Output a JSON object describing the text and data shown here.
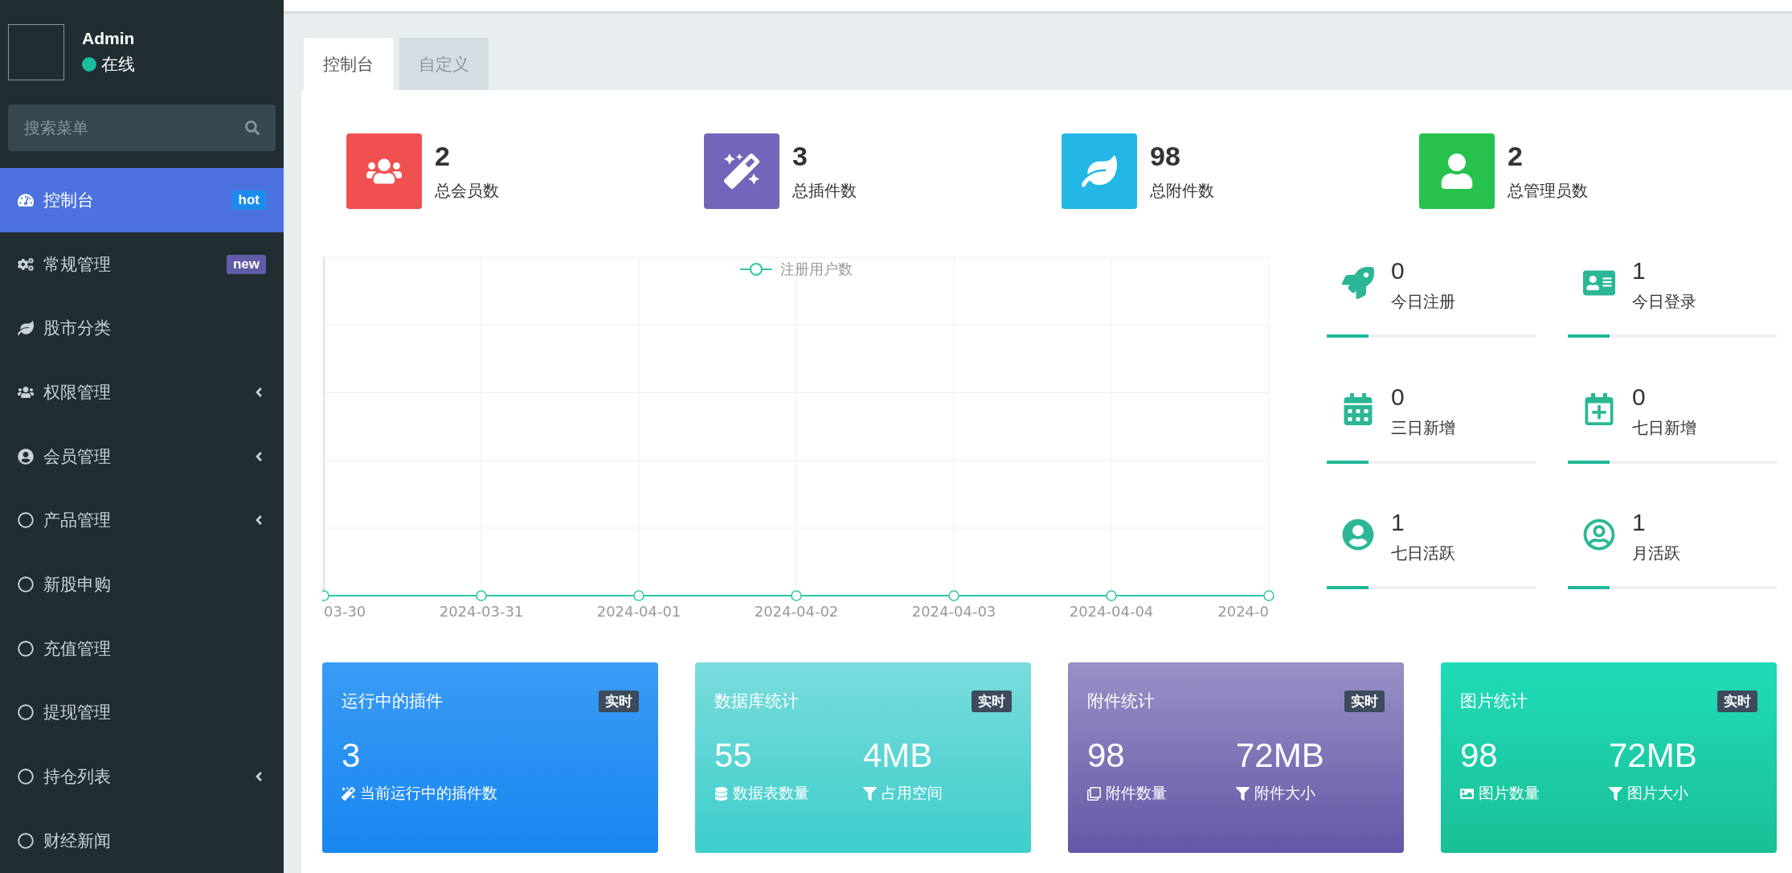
{
  "sidebar": {
    "user": {
      "name": "Admin",
      "status": "在线",
      "online": true
    },
    "search": {
      "placeholder": "搜索菜单"
    },
    "menu": [
      {
        "label": "控制台",
        "selected": true,
        "expandable": false,
        "badge": {
          "text": "hot",
          "color": "#1a8cf0"
        }
      },
      {
        "label": "常规管理",
        "selected": false,
        "expandable": false,
        "badge": {
          "text": "new",
          "color": "#605ca8"
        }
      },
      {
        "label": "股市分类",
        "selected": false,
        "expandable": false
      },
      {
        "label": "权限管理",
        "selected": false,
        "expandable": true
      },
      {
        "label": "会员管理",
        "selected": false,
        "expandable": true
      },
      {
        "label": "产品管理",
        "selected": false,
        "expandable": true
      },
      {
        "label": "新股申购",
        "selected": false,
        "expandable": false
      },
      {
        "label": "充值管理",
        "selected": false,
        "expandable": false
      },
      {
        "label": "提现管理",
        "selected": false,
        "expandable": false
      },
      {
        "label": "持仓列表",
        "selected": false,
        "expandable": true
      },
      {
        "label": "财经新闻",
        "selected": false,
        "expandable": false
      }
    ]
  },
  "tabs": [
    {
      "label": "控制台",
      "selected": true
    },
    {
      "label": "自定义",
      "selected": false
    }
  ],
  "stats": [
    {
      "value": "2",
      "label": "总会员数",
      "color": "#f05050"
    },
    {
      "value": "3",
      "label": "总插件数",
      "color": "#7266ba"
    },
    {
      "value": "98",
      "label": "总附件数",
      "color": "#23b7e5"
    },
    {
      "value": "2",
      "label": "总管理员数",
      "color": "#27c24c"
    }
  ],
  "chart": {
    "legend": "注册用户数",
    "x_labels": [
      "03-30",
      "2024-03-31",
      "2024-04-01",
      "2024-04-02",
      "2024-04-03",
      "2024-04-04",
      "2024-0"
    ]
  },
  "quick_stats": [
    {
      "value": "0",
      "label": "今日注册",
      "level": 0.2
    },
    {
      "value": "1",
      "label": "今日登录",
      "level": 0.2
    },
    {
      "value": "0",
      "label": "三日新增",
      "level": 0.2
    },
    {
      "value": "0",
      "label": "七日新增",
      "level": 0.2
    },
    {
      "value": "1",
      "label": "七日活跃",
      "level": 0.2
    },
    {
      "value": "1",
      "label": "月活跃",
      "level": 0.2
    }
  ],
  "cards": [
    {
      "title": "运行中的插件",
      "badge": "实时",
      "metrics": [
        {
          "value": "3",
          "label": "当前运行中的插件数"
        }
      ]
    },
    {
      "title": "数据库统计",
      "badge": "实时",
      "metrics": [
        {
          "value": "55",
          "label": "数据表数量"
        },
        {
          "value": "4MB",
          "label": "占用空间"
        }
      ]
    },
    {
      "title": "附件统计",
      "badge": "实时",
      "metrics": [
        {
          "value": "98",
          "label": "附件数量"
        },
        {
          "value": "72MB",
          "label": "附件大小"
        }
      ]
    },
    {
      "title": "图片统计",
      "badge": "实时",
      "metrics": [
        {
          "value": "98",
          "label": "图片数量"
        },
        {
          "value": "72MB",
          "label": "图片大小"
        }
      ]
    }
  ]
}
